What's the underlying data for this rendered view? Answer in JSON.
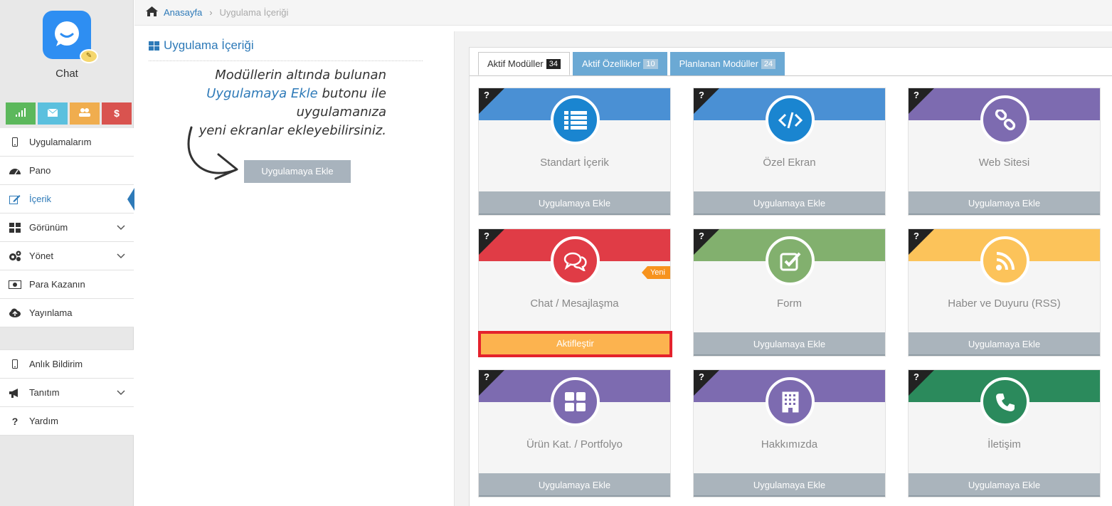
{
  "app": {
    "name": "Chat",
    "icon": "chat-bubble-icon"
  },
  "quick_buttons": [
    {
      "name": "stats",
      "icon": "signal-icon",
      "color": "#5cb85c"
    },
    {
      "name": "mail",
      "icon": "envelope-icon",
      "color": "#5bc0de"
    },
    {
      "name": "users",
      "icon": "users-icon",
      "color": "#f0ad4e"
    },
    {
      "name": "money",
      "icon": "dollar-icon",
      "label": "$",
      "color": "#d9534f"
    }
  ],
  "sidebar": {
    "items": [
      {
        "label": "Uygulamalarım",
        "icon": "mobile-icon"
      },
      {
        "label": "Pano",
        "icon": "dashboard-icon"
      },
      {
        "label": "İçerik",
        "icon": "edit-icon"
      },
      {
        "label": "Görünüm",
        "icon": "grid-icon"
      },
      {
        "label": "Yönet",
        "icon": "cogs-icon"
      },
      {
        "label": "Para Kazanın",
        "icon": "money-icon"
      },
      {
        "label": "Yayınlama",
        "icon": "cloud-upload-icon"
      }
    ],
    "items2": [
      {
        "label": "Anlık Bildirim",
        "icon": "mobile-icon"
      },
      {
        "label": "Tanıtım",
        "icon": "bullhorn-icon"
      },
      {
        "label": "Yardım",
        "icon": "question-icon"
      }
    ]
  },
  "breadcrumb": {
    "home": "Anasayfa",
    "separator": "›",
    "current": "Uygulama İçeriği"
  },
  "left_panel": {
    "title": "Uygulama İçeriği",
    "hint_line1": "Modüllerin altında bulunan",
    "hint_highlight": "Uygulamaya Ekle",
    "hint_line2_rest": " butonu ile uygulamanıza",
    "hint_line3": "yeni ekranlar ekleyebilirsiniz.",
    "demo_button": "Uygulamaya Ekle"
  },
  "tabs": [
    {
      "label": "Aktif Modüller",
      "count": "34"
    },
    {
      "label": "Aktif Özellikler",
      "count": "10"
    },
    {
      "label": "Planlanan Modüller",
      "count": "24"
    }
  ],
  "cards": [
    {
      "name": "Standart İçerik",
      "button": "Uygulamaya Ekle",
      "color": "#4a90d4",
      "circle": "#1a85d0",
      "icon": "list-icon",
      "help": "?"
    },
    {
      "name": "Özel Ekran",
      "button": "Uygulamaya Ekle",
      "color": "#4a90d4",
      "circle": "#1a85d0",
      "icon": "code-icon",
      "help": "?"
    },
    {
      "name": "Web Sitesi",
      "button": "Uygulamaya Ekle",
      "color": "#7d6bb0",
      "circle": "#7d6bb0",
      "icon": "link-icon",
      "help": "?"
    },
    {
      "name": "Chat / Mesajlaşma",
      "button": "Aktifleştir",
      "color": "#e03c46",
      "circle": "#e03c46",
      "icon": "comments-icon",
      "help": "?",
      "badge": "Yeni"
    },
    {
      "name": "Form",
      "button": "Uygulamaya Ekle",
      "color": "#82b06e",
      "circle": "#82b06e",
      "icon": "check-square-icon",
      "help": "?"
    },
    {
      "name": "Haber ve Duyuru (RSS)",
      "button": "Uygulamaya Ekle",
      "color": "#fcc35a",
      "circle": "#fcc35a",
      "icon": "rss-icon",
      "help": "?"
    },
    {
      "name": "Ürün Kat. / Portfolyo",
      "button": "Uygulamaya Ekle",
      "color": "#7d6bb0",
      "circle": "#7d6bb0",
      "icon": "grid-icon",
      "help": "?"
    },
    {
      "name": "Hakkımızda",
      "button": "Uygulamaya Ekle",
      "color": "#7d6bb0",
      "circle": "#7d6bb0",
      "icon": "building-icon",
      "help": "?"
    },
    {
      "name": "İletişim",
      "button": "Uygulamaya Ekle",
      "color": "#2b8a5c",
      "circle": "#2b8a5c",
      "icon": "phone-icon",
      "help": "?"
    }
  ]
}
